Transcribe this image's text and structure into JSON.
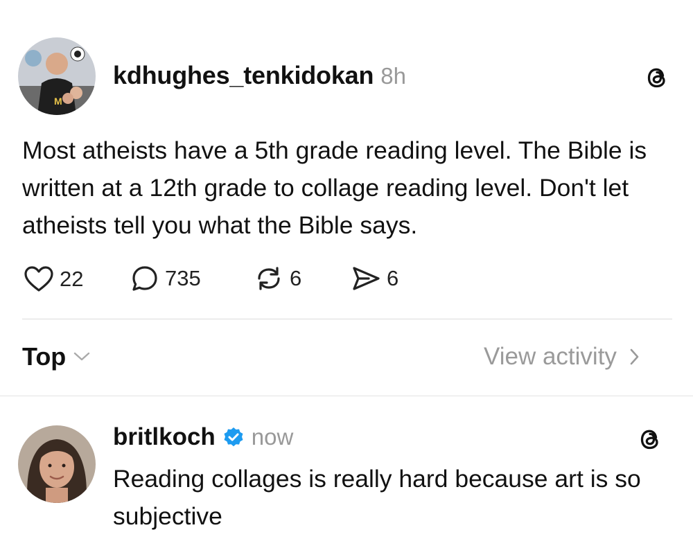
{
  "post": {
    "username": "kdhughes_tenkidokan",
    "time": "8h",
    "text": "Most atheists have a 5th grade reading level. The Bible is written at a 12th grade to collage reading level. Don't let atheists tell you what the Bible says.",
    "likes": "22",
    "replies": "735",
    "reposts": "6",
    "shares": "6",
    "avatar_badge": "M"
  },
  "sort": {
    "label": "Top",
    "view_activity": "View activity"
  },
  "reply": {
    "username": "britlkoch",
    "time": "now",
    "text": "Reading collages is really hard because art is so subjective",
    "verified": true
  },
  "colors": {
    "verified_blue": "#1d9bf0",
    "muted_text": "#999999",
    "divider": "#dcdcdc"
  },
  "icons": [
    "heart-icon",
    "comment-icon",
    "repost-icon",
    "share-icon",
    "threads-logo-icon",
    "chevron-down-icon",
    "chevron-right-icon",
    "verified-badge-icon"
  ]
}
